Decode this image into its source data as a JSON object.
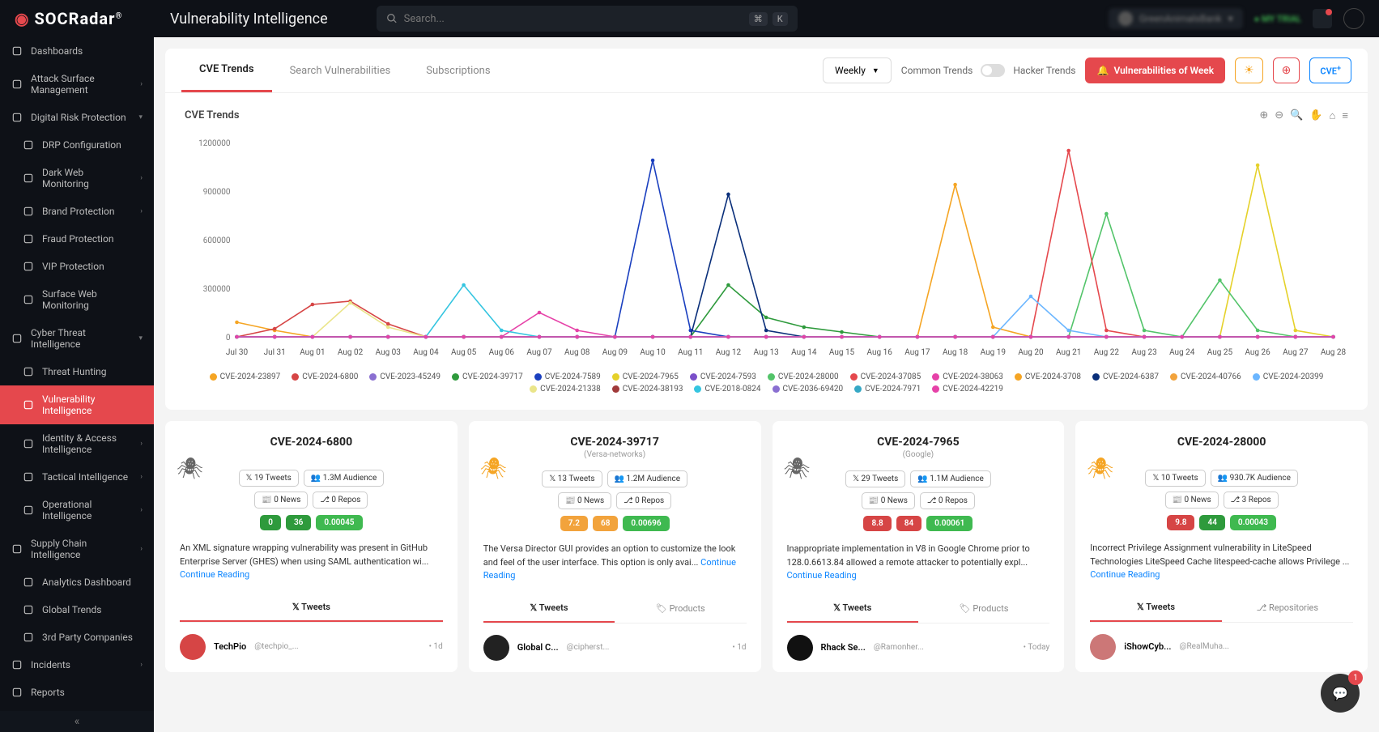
{
  "header": {
    "brand": "SOCRadar",
    "title": "Vulnerability Intelligence",
    "search_placeholder": "Search...",
    "kbd1": "⌘",
    "kbd2": "K",
    "org": "GreenAnimalsBank",
    "trial": "MY TRIAL"
  },
  "sidebar": [
    {
      "label": "Dashboards",
      "chev": false
    },
    {
      "label": "Attack Surface Management",
      "chev": true
    },
    {
      "label": "Digital Risk Protection",
      "chev": true,
      "open": true
    },
    {
      "label": "DRP Configuration",
      "chev": false,
      "indent": true
    },
    {
      "label": "Dark Web Monitoring",
      "chev": true,
      "indent": true
    },
    {
      "label": "Brand Protection",
      "chev": true,
      "indent": true
    },
    {
      "label": "Fraud Protection",
      "chev": false,
      "indent": true
    },
    {
      "label": "VIP Protection",
      "chev": false,
      "indent": true
    },
    {
      "label": "Surface Web Monitoring",
      "chev": false,
      "indent": true
    },
    {
      "label": "Cyber Threat Intelligence",
      "chev": true,
      "open": true
    },
    {
      "label": "Threat Hunting",
      "chev": false,
      "indent": true
    },
    {
      "label": "Vulnerability Intelligence",
      "chev": false,
      "indent": true,
      "active": true
    },
    {
      "label": "Identity & Access Intelligence",
      "chev": true,
      "indent": true
    },
    {
      "label": "Tactical Intelligence",
      "chev": true,
      "indent": true
    },
    {
      "label": "Operational Intelligence",
      "chev": true,
      "indent": true
    },
    {
      "label": "Supply Chain Intelligence",
      "chev": true
    },
    {
      "label": "Analytics Dashboard",
      "chev": false,
      "indent": true
    },
    {
      "label": "Global Trends",
      "chev": false,
      "indent": true
    },
    {
      "label": "3rd Party Companies",
      "chev": false,
      "indent": true
    },
    {
      "label": "Incidents",
      "chev": true
    },
    {
      "label": "Reports",
      "chev": false
    }
  ],
  "tabs": {
    "items": [
      "CVE Trends",
      "Search Vulnerabilities",
      "Subscriptions"
    ],
    "active": 0
  },
  "controls": {
    "period": "Weekly",
    "common": "Common Trends",
    "hacker": "Hacker Trends",
    "vuln_week": "Vulnerabilities of Week",
    "cve_btn": "CVE"
  },
  "chart_data": {
    "type": "line",
    "title": "CVE Trends",
    "ylabel": "",
    "ylim": [
      0,
      1200000
    ],
    "yticks": [
      0,
      300000,
      600000,
      900000,
      1200000
    ],
    "categories": [
      "Jul 30",
      "Jul 31",
      "Aug 01",
      "Aug 02",
      "Aug 03",
      "Aug 04",
      "Aug 05",
      "Aug 06",
      "Aug 07",
      "Aug 08",
      "Aug 09",
      "Aug 10",
      "Aug 11",
      "Aug 12",
      "Aug 13",
      "Aug 14",
      "Aug 15",
      "Aug 16",
      "Aug 17",
      "Aug 18",
      "Aug 19",
      "Aug 20",
      "Aug 21",
      "Aug 22",
      "Aug 23",
      "Aug 24",
      "Aug 25",
      "Aug 26",
      "Aug 27",
      "Aug 28"
    ],
    "series": [
      {
        "name": "CVE-2024-23897",
        "color": "#f5a524",
        "values": [
          90000,
          40000,
          0,
          0,
          0,
          0,
          0,
          0,
          0,
          0,
          0,
          0,
          0,
          0,
          0,
          0,
          0,
          0,
          0,
          0,
          0,
          0,
          0,
          0,
          0,
          0,
          0,
          0,
          0,
          0
        ]
      },
      {
        "name": "CVE-2024-6800",
        "color": "#d64545",
        "values": [
          0,
          50000,
          200000,
          220000,
          80000,
          0,
          0,
          0,
          0,
          0,
          0,
          0,
          0,
          0,
          0,
          0,
          0,
          0,
          0,
          0,
          0,
          0,
          0,
          0,
          0,
          0,
          0,
          0,
          0,
          0
        ]
      },
      {
        "name": "CVE-2023-45249",
        "color": "#8a6fd1",
        "values": [
          0,
          0,
          0,
          0,
          0,
          0,
          0,
          0,
          0,
          0,
          0,
          0,
          0,
          0,
          0,
          0,
          0,
          0,
          0,
          0,
          0,
          0,
          0,
          0,
          0,
          0,
          0,
          0,
          0,
          0
        ]
      },
      {
        "name": "CVE-2024-39717",
        "color": "#2e9a3c",
        "values": [
          0,
          0,
          0,
          0,
          0,
          0,
          0,
          0,
          0,
          0,
          0,
          0,
          0,
          320000,
          120000,
          60000,
          30000,
          0,
          0,
          0,
          0,
          0,
          0,
          0,
          0,
          0,
          0,
          0,
          0,
          0
        ]
      },
      {
        "name": "CVE-2024-7589",
        "color": "#1a3fbf",
        "values": [
          0,
          0,
          0,
          0,
          0,
          0,
          0,
          0,
          0,
          0,
          0,
          1090000,
          40000,
          0,
          0,
          0,
          0,
          0,
          0,
          0,
          0,
          0,
          0,
          0,
          0,
          0,
          0,
          0,
          0,
          0
        ]
      },
      {
        "name": "CVE-2024-7965",
        "color": "#e5d12a",
        "values": [
          0,
          0,
          0,
          0,
          0,
          0,
          0,
          0,
          0,
          0,
          0,
          0,
          0,
          0,
          0,
          0,
          0,
          0,
          0,
          0,
          0,
          0,
          0,
          0,
          0,
          0,
          0,
          1060000,
          40000,
          0
        ]
      },
      {
        "name": "CVE-2024-7593",
        "color": "#7a4fc9",
        "values": [
          0,
          0,
          0,
          0,
          0,
          0,
          0,
          0,
          0,
          0,
          0,
          0,
          0,
          0,
          0,
          0,
          0,
          0,
          0,
          0,
          0,
          0,
          0,
          0,
          0,
          0,
          0,
          0,
          0,
          0
        ]
      },
      {
        "name": "CVE-2024-28000",
        "color": "#53c46a",
        "values": [
          0,
          0,
          0,
          0,
          0,
          0,
          0,
          0,
          0,
          0,
          0,
          0,
          0,
          0,
          0,
          0,
          0,
          0,
          0,
          0,
          0,
          0,
          0,
          760000,
          40000,
          0,
          350000,
          40000,
          0,
          0
        ]
      },
      {
        "name": "CVE-2024-37085",
        "color": "#e5484d",
        "values": [
          0,
          0,
          0,
          0,
          0,
          0,
          0,
          0,
          0,
          0,
          0,
          0,
          0,
          0,
          0,
          0,
          0,
          0,
          0,
          0,
          0,
          0,
          1150000,
          40000,
          0,
          0,
          0,
          0,
          0,
          0
        ]
      },
      {
        "name": "CVE-2024-38063",
        "color": "#e642a8",
        "values": [
          0,
          0,
          0,
          0,
          0,
          0,
          0,
          0,
          150000,
          40000,
          0,
          0,
          0,
          0,
          0,
          0,
          0,
          0,
          0,
          0,
          0,
          0,
          0,
          0,
          0,
          0,
          0,
          0,
          0,
          0
        ]
      },
      {
        "name": "CVE-2024-3708",
        "color": "#f5a524",
        "values": [
          0,
          0,
          0,
          0,
          0,
          0,
          0,
          0,
          0,
          0,
          0,
          0,
          0,
          0,
          0,
          0,
          0,
          0,
          0,
          940000,
          60000,
          0,
          0,
          0,
          0,
          0,
          0,
          0,
          0,
          0
        ]
      },
      {
        "name": "CVE-2024-6387",
        "color": "#0a2f7a",
        "values": [
          0,
          0,
          0,
          0,
          0,
          0,
          0,
          0,
          0,
          0,
          0,
          0,
          0,
          880000,
          40000,
          0,
          0,
          0,
          0,
          0,
          0,
          0,
          0,
          0,
          0,
          0,
          0,
          0,
          0,
          0
        ]
      },
      {
        "name": "CVE-2024-40766",
        "color": "#f2a33c",
        "values": [
          0,
          0,
          0,
          0,
          0,
          0,
          0,
          0,
          0,
          0,
          0,
          0,
          0,
          0,
          0,
          0,
          0,
          0,
          0,
          0,
          0,
          0,
          0,
          0,
          0,
          0,
          0,
          0,
          0,
          0
        ]
      },
      {
        "name": "CVE-2024-20399",
        "color": "#6bb6ff",
        "values": [
          0,
          0,
          0,
          0,
          0,
          0,
          0,
          0,
          0,
          0,
          0,
          0,
          0,
          0,
          0,
          0,
          0,
          0,
          0,
          0,
          0,
          250000,
          40000,
          0,
          0,
          0,
          0,
          0,
          0,
          0
        ]
      },
      {
        "name": "CVE-2024-21338",
        "color": "#eae58a",
        "values": [
          0,
          0,
          0,
          210000,
          60000,
          0,
          0,
          0,
          0,
          0,
          0,
          0,
          0,
          0,
          0,
          0,
          0,
          0,
          0,
          0,
          0,
          0,
          0,
          0,
          0,
          0,
          0,
          0,
          0,
          0
        ]
      },
      {
        "name": "CVE-2024-38193",
        "color": "#a03a3a",
        "values": [
          0,
          0,
          0,
          0,
          0,
          0,
          0,
          0,
          0,
          0,
          0,
          0,
          0,
          0,
          0,
          0,
          0,
          0,
          0,
          0,
          0,
          0,
          0,
          0,
          0,
          0,
          0,
          0,
          0,
          0
        ]
      },
      {
        "name": "CVE-2018-0824",
        "color": "#35c5e0",
        "values": [
          0,
          0,
          0,
          0,
          0,
          0,
          320000,
          40000,
          0,
          0,
          0,
          0,
          0,
          0,
          0,
          0,
          0,
          0,
          0,
          0,
          0,
          0,
          0,
          0,
          0,
          0,
          0,
          0,
          0,
          0
        ]
      },
      {
        "name": "CVE-2036-69420",
        "color": "#8a6fd1",
        "values": [
          0,
          0,
          0,
          0,
          0,
          0,
          0,
          0,
          0,
          0,
          0,
          0,
          0,
          0,
          0,
          0,
          0,
          0,
          0,
          0,
          0,
          0,
          0,
          0,
          0,
          0,
          0,
          0,
          0,
          0
        ]
      },
      {
        "name": "CVE-2024-7971",
        "color": "#35a8c5",
        "values": [
          0,
          0,
          0,
          0,
          0,
          0,
          0,
          0,
          0,
          0,
          0,
          0,
          0,
          0,
          0,
          0,
          0,
          0,
          0,
          0,
          0,
          0,
          0,
          0,
          0,
          0,
          0,
          0,
          0,
          0
        ]
      },
      {
        "name": "CVE-2024-42219",
        "color": "#e642a8",
        "values": [
          0,
          0,
          0,
          0,
          0,
          0,
          0,
          0,
          0,
          0,
          0,
          0,
          0,
          0,
          0,
          0,
          0,
          0,
          0,
          0,
          0,
          0,
          0,
          0,
          0,
          0,
          0,
          0,
          0,
          0
        ]
      }
    ]
  },
  "cards": [
    {
      "id": "CVE-2024-6800",
      "vendor": "",
      "bug": "#666",
      "tweets": "19 Tweets",
      "aud": "1.3M Audience",
      "news": "0 News",
      "repos": "0 Repos",
      "c1": "0",
      "c1c": "green",
      "c2": "36",
      "c2c": "green",
      "c3": "0.00045",
      "c3c": "lgreen",
      "desc": "An XML signature wrapping vulnerability was present in GitHub Enterprise Server (GHES) when using SAML authentication wi...",
      "tabs": [
        "Tweets"
      ],
      "tw_name": "TechPio",
      "tw_handle": "@techpio_...",
      "tw_time": "1d",
      "tw_av": "#d64545"
    },
    {
      "id": "CVE-2024-39717",
      "vendor": "(Versa-networks)",
      "bug": "#f5a524",
      "tweets": "13 Tweets",
      "aud": "1.2M Audience",
      "news": "0 News",
      "repos": "0 Repos",
      "c1": "7.2",
      "c1c": "orange",
      "c2": "68",
      "c2c": "orange",
      "c3": "0.00696",
      "c3c": "lgreen",
      "desc": "The Versa Director GUI provides an option to customize the look and feel of the user interface. This option is only avai...",
      "tabs": [
        "Tweets",
        "Products"
      ],
      "tw_name": "Global C...",
      "tw_handle": "@cipherst...",
      "tw_time": "1d",
      "tw_av": "#222"
    },
    {
      "id": "CVE-2024-7965",
      "vendor": "(Google)",
      "bug": "#666",
      "tweets": "29 Tweets",
      "aud": "1.1M Audience",
      "news": "0 News",
      "repos": "0 Repos",
      "c1": "8.8",
      "c1c": "red",
      "c2": "84",
      "c2c": "red",
      "c3": "0.00061",
      "c3c": "lgreen",
      "desc": "Inappropriate implementation in V8 in Google Chrome prior to 128.0.6613.84 allowed a remote attacker to potentially expl...",
      "tabs": [
        "Tweets",
        "Products"
      ],
      "tw_name": "Rhack Se...",
      "tw_handle": "@Ramonher...",
      "tw_time": "Today",
      "tw_av": "#111"
    },
    {
      "id": "CVE-2024-28000",
      "vendor": "",
      "bug": "#f5a524",
      "tweets": "10 Tweets",
      "aud": "930.7K Audience",
      "news": "0 News",
      "repos": "3 Repos",
      "c1": "9.8",
      "c1c": "red",
      "c2": "44",
      "c2c": "green",
      "c3": "0.00043",
      "c3c": "lgreen",
      "desc": "Incorrect Privilege Assignment vulnerability in LiteSpeed Technologies LiteSpeed Cache litespeed-cache allows Privilege ...",
      "tabs": [
        "Tweets",
        "Repositories"
      ],
      "tw_name": "iShowCyb...",
      "tw_handle": "@RealMuha...",
      "tw_time": "",
      "tw_av": "#c77"
    }
  ],
  "labels": {
    "continue": "Continue Reading",
    "tweets": "Tweets",
    "products": "Products",
    "repos": "Repositories"
  }
}
